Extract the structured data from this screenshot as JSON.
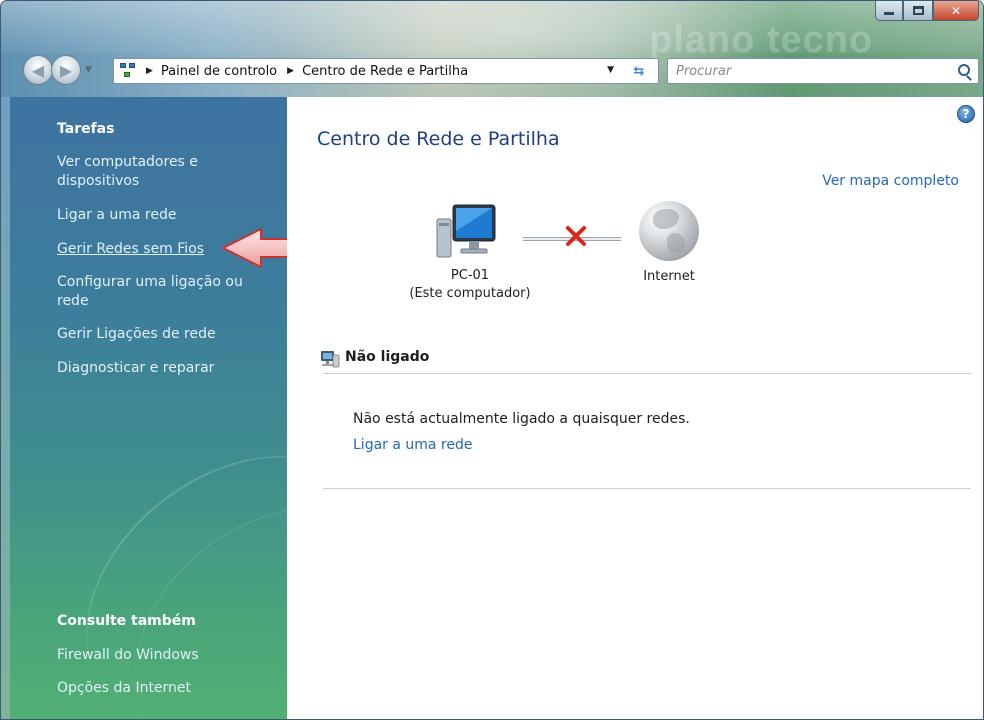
{
  "window": {
    "watermark": "plano tecno"
  },
  "address_bar": {
    "breadcrumbs": [
      "Painel de controlo",
      "Centro de Rede e Partilha"
    ]
  },
  "search": {
    "placeholder": "Procurar"
  },
  "sidebar": {
    "tasks_heading": "Tarefas",
    "tasks": [
      "Ver computadores e dispositivos",
      "Ligar a uma rede",
      "Gerir Redes sem Fios",
      "Configurar uma ligação ou rede",
      "Gerir Ligações de rede",
      "Diagnosticar e reparar"
    ],
    "see_also_heading": "Consulte também",
    "see_also": [
      "Firewall do Windows",
      "Opções da Internet"
    ]
  },
  "main": {
    "title": "Centro de Rede e Partilha",
    "map_link": "Ver mapa completo",
    "computer_name": "PC-01",
    "computer_subtitle": "(Este computador)",
    "internet_label": "Internet",
    "status_title": "Não ligado",
    "status_message": "Não está actualmente ligado a quaisquer redes.",
    "connect_link": "Ligar a uma rede"
  },
  "icons": {
    "back": "back-arrow-icon",
    "forward": "forward-arrow-icon",
    "refresh": "refresh-icon",
    "search": "search-icon",
    "help": "help-icon",
    "computer": "computer-icon",
    "globe": "globe-icon",
    "disconnected": "x-mark-icon",
    "network_status": "network-status-icon"
  },
  "colors": {
    "link": "#2468b8",
    "title": "#1e3f87",
    "sidebar_top": "#3e73a1",
    "sidebar_bottom": "#52b073",
    "disconnected_x": "#d9261c"
  }
}
